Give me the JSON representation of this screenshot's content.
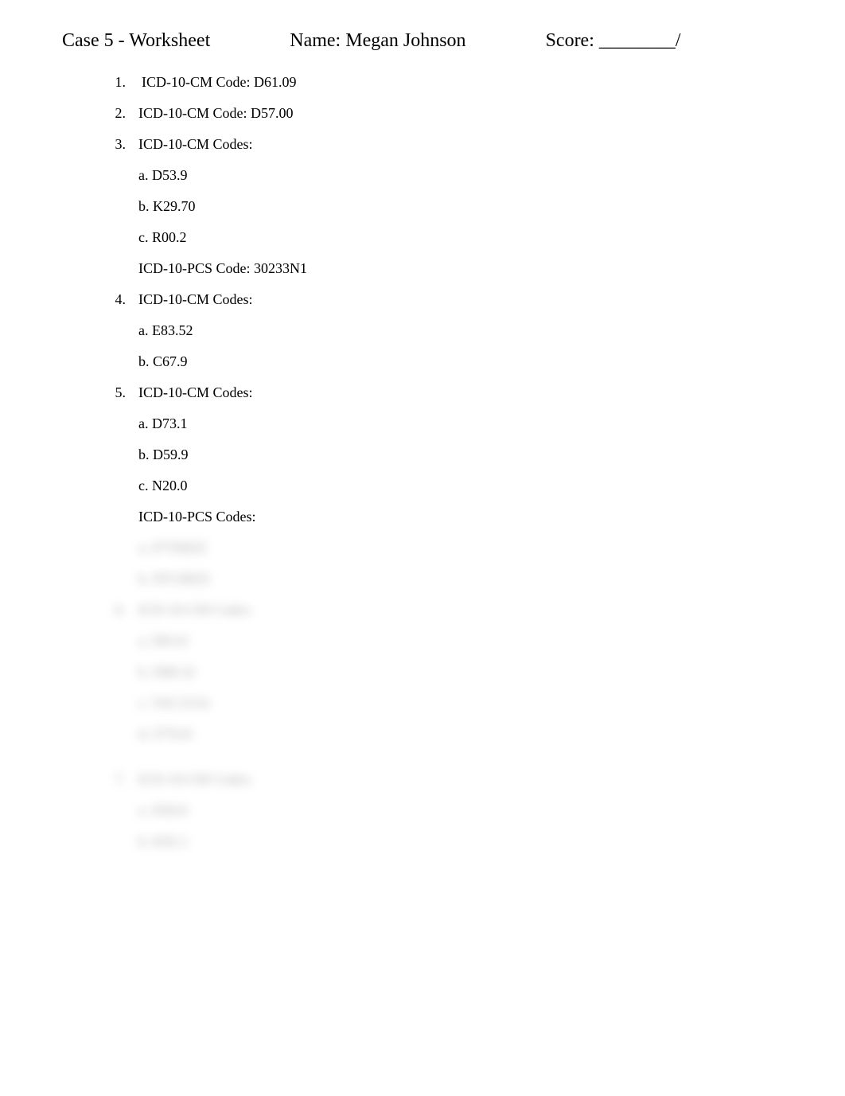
{
  "header": {
    "title": "Case 5 - Worksheet",
    "name_label": "Name:",
    "name_value": "Megan Johnson",
    "score_label": "Score:",
    "score_blank": "________",
    "score_suffix": "/"
  },
  "questions": [
    {
      "number": "1.",
      "prefix_label": "ICD-10-CM Code:",
      "code_value": "D61.09"
    },
    {
      "number": "2.",
      "prefix_label": "ICD-10-CM Code:",
      "code_value": "D57.00"
    },
    {
      "number": "3.",
      "prefix_label": "ICD-10-CM Codes:",
      "subs": [
        {
          "label": "a.",
          "value": "D53.9"
        },
        {
          "label": "b.",
          "value": "K29.70"
        },
        {
          "label": "c.",
          "value": "R00.2"
        }
      ],
      "extra_label": "ICD-10-PCS Code:",
      "extra_value": "30233N1"
    },
    {
      "number": "4.",
      "prefix_label": "ICD-10-CM Codes:",
      "subs": [
        {
          "label": "a.",
          "value": "E83.52"
        },
        {
          "label": "b.",
          "value": "C67.9"
        }
      ]
    },
    {
      "number": "5.",
      "prefix_label": "ICD-10-CM Codes:",
      "subs": [
        {
          "label": "a.",
          "value": "D73.1"
        },
        {
          "label": "b.",
          "value": "D59.9"
        },
        {
          "label": "c.",
          "value": "N20.0"
        }
      ],
      "extra_label": "ICD-10-PCS Codes:"
    }
  ],
  "blurred": {
    "q5_subs": [
      {
        "text": "a. 07T00ZZ"
      },
      {
        "text": "b. 0TC00ZZ"
      }
    ],
    "q6": {
      "number": "6.",
      "prefix_label": "ICD-10-CM Codes:",
      "subs": [
        {
          "text": "a. D63.0"
        },
        {
          "text": "b. D68.32"
        },
        {
          "text": "c. T45.515A"
        },
        {
          "text": "d. Z79.01"
        }
      ]
    },
    "q7": {
      "number": "7.",
      "prefix_label": "ICD-10-CM Codes:",
      "subs": [
        {
          "text": "a. D50.0"
        },
        {
          "text": "b. K92.1"
        }
      ]
    }
  }
}
